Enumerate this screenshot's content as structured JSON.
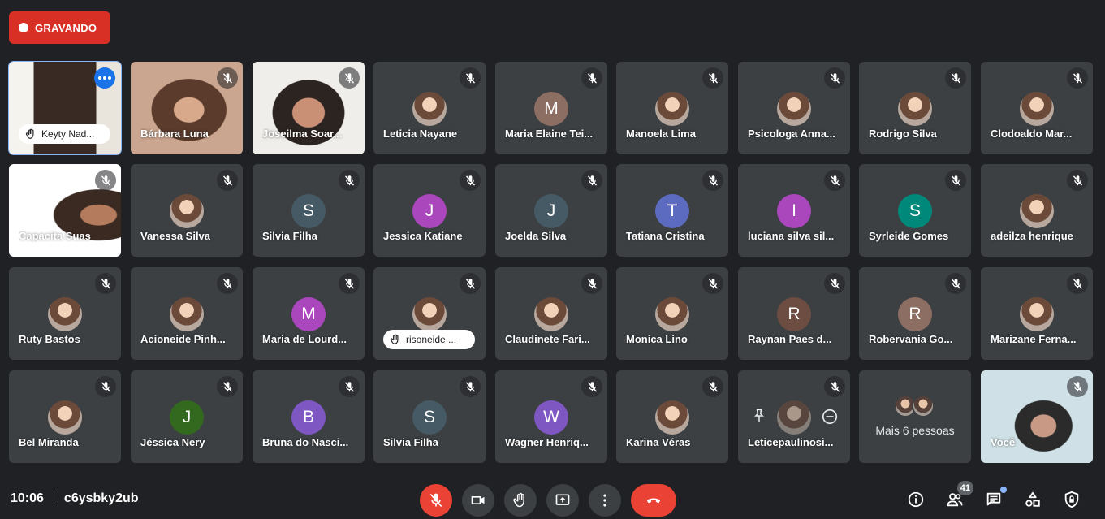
{
  "recording": {
    "label": "GRAVANDO"
  },
  "participants": [
    {
      "name": "Keyty Nad...",
      "kind": "video",
      "hand": true
    },
    {
      "name": "Bárbara Luna",
      "kind": "video"
    },
    {
      "name": "Joseilma Soar...",
      "kind": "video"
    },
    {
      "name": "Leticia Nayane",
      "kind": "photo"
    },
    {
      "name": "Maria Elaine Tei...",
      "kind": "letter",
      "initial": "M",
      "color": "#8d6e63"
    },
    {
      "name": "Manoela Lima",
      "kind": "photo"
    },
    {
      "name": "Psicologa Anna...",
      "kind": "photo"
    },
    {
      "name": "Rodrigo Silva",
      "kind": "photo"
    },
    {
      "name": "Clodoaldo Mar...",
      "kind": "photo"
    },
    {
      "name": "Capacita Suas",
      "kind": "video"
    },
    {
      "name": "Vanessa Silva",
      "kind": "photo"
    },
    {
      "name": "Silvia Filha",
      "kind": "letter",
      "initial": "S",
      "color": "#455a64"
    },
    {
      "name": "Jessica Katiane",
      "kind": "letter",
      "initial": "J",
      "color": "#ab47bc"
    },
    {
      "name": "Joelda Silva",
      "kind": "letter",
      "initial": "J",
      "color": "#455a64"
    },
    {
      "name": "Tatiana Cristina",
      "kind": "letter",
      "initial": "T",
      "color": "#5c6bc0"
    },
    {
      "name": "luciana silva sil...",
      "kind": "letter",
      "initial": "I",
      "color": "#ab47bc"
    },
    {
      "name": "Syrleide Gomes",
      "kind": "letter",
      "initial": "S",
      "color": "#00897b"
    },
    {
      "name": "adeilza henrique",
      "kind": "photo"
    },
    {
      "name": "Ruty Bastos",
      "kind": "photo"
    },
    {
      "name": "Acioneide Pinh...",
      "kind": "photo"
    },
    {
      "name": "Maria de Lourd...",
      "kind": "letter",
      "initial": "M",
      "color": "#ab47bc"
    },
    {
      "name": "risoneide ...",
      "kind": "photo",
      "hand": true
    },
    {
      "name": "Claudinete Fari...",
      "kind": "photo"
    },
    {
      "name": "Monica Lino",
      "kind": "photo"
    },
    {
      "name": "Raynan Paes d...",
      "kind": "letter",
      "initial": "R",
      "color": "#6d4c41"
    },
    {
      "name": "Robervania Go...",
      "kind": "letter",
      "initial": "R",
      "color": "#8d6e63"
    },
    {
      "name": "Marizane Ferna...",
      "kind": "photo"
    },
    {
      "name": "Bel Miranda",
      "kind": "photo"
    },
    {
      "name": "Jéssica Nery",
      "kind": "letter",
      "initial": "J",
      "color": "#33691e"
    },
    {
      "name": "Bruna do Nasci...",
      "kind": "letter",
      "initial": "B",
      "color": "#7e57c2"
    },
    {
      "name": "Silvia Filha",
      "kind": "letter",
      "initial": "S",
      "color": "#455a64"
    },
    {
      "name": "Wagner Henriq...",
      "kind": "letter",
      "initial": "W",
      "color": "#7e57c2"
    },
    {
      "name": "Karina Véras",
      "kind": "photo"
    },
    {
      "name": "Leticepaulinosi...",
      "kind": "hover"
    },
    {
      "name": "Mais 6 pessoas",
      "kind": "more"
    },
    {
      "name": "Você",
      "kind": "video"
    }
  ],
  "bottom": {
    "time": "10:06",
    "meeting_code": "c6ysbky2ub",
    "people_count": "41"
  }
}
